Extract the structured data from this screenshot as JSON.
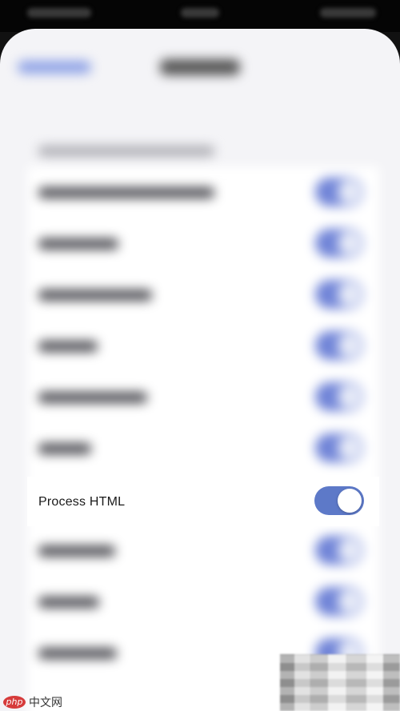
{
  "settings": {
    "focused_row": {
      "label": "Process HTML",
      "toggle_on": true
    }
  },
  "colors": {
    "accent": "#5d79c8",
    "background": "#f4f4f7",
    "row_background": "#ffffff"
  },
  "watermark": {
    "logo": "php",
    "text": "中文网"
  }
}
